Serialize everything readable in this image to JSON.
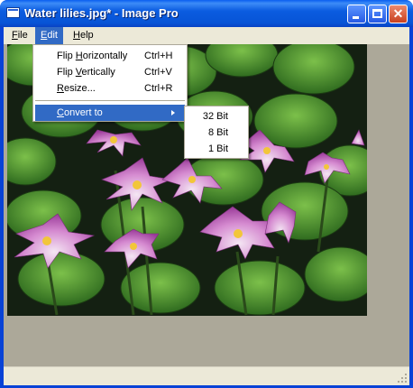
{
  "window": {
    "title": "Water lilies.jpg* - Image Pro",
    "close_glyph": "✕"
  },
  "menubar": {
    "file": "File",
    "file_key": "F",
    "file_rest": "ile",
    "edit": "Edit",
    "edit_key": "E",
    "edit_rest": "dit",
    "help": "Help",
    "help_key": "H",
    "help_rest": "elp"
  },
  "edit_menu": {
    "items": [
      {
        "label_pre": "Flip ",
        "label_key": "H",
        "label_post": "orizontally",
        "shortcut": "Ctrl+H"
      },
      {
        "label_pre": "Flip ",
        "label_key": "V",
        "label_post": "ertically",
        "shortcut": "Ctrl+V"
      },
      {
        "label_pre": "",
        "label_key": "R",
        "label_post": "esize...",
        "shortcut": "Ctrl+R"
      },
      {
        "label_pre": "",
        "label_key": "C",
        "label_post": "onvert to",
        "shortcut": ""
      }
    ]
  },
  "convert_submenu": {
    "items": [
      "32 Bit",
      "8 Bit",
      "1 Bit"
    ]
  },
  "icons": {
    "app": "window-icon",
    "minimize": "minimize-icon",
    "maximize": "maximize-icon",
    "close": "close-icon",
    "submenu": "chevron-right-icon",
    "resize_grip": "resize-grip-icon"
  },
  "colors": {
    "title_bar": "#0754d6",
    "menu_highlight": "#316ac5",
    "workspace": "#aca899",
    "chrome": "#ece9d8"
  }
}
